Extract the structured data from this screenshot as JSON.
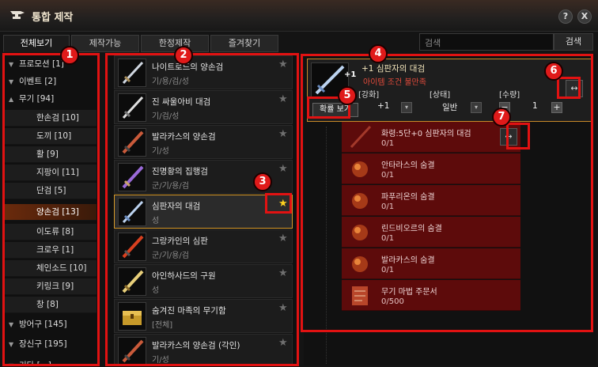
{
  "window": {
    "title": "통합 제작",
    "help_label": "?",
    "close_label": "X"
  },
  "tabs": [
    {
      "label": "전체보기"
    },
    {
      "label": "제작가능"
    },
    {
      "label": "한정제작"
    },
    {
      "label": "즐겨찾기"
    }
  ],
  "search": {
    "placeholder": "검색",
    "button_label": "검색"
  },
  "categories": [
    {
      "label": "프로모션 [1]",
      "arrow": "▼"
    },
    {
      "label": "이벤트 [2]",
      "arrow": "▼"
    },
    {
      "label": "무기 [94]",
      "arrow": "▲"
    },
    {
      "label": "한손검 [10]"
    },
    {
      "label": "도끼 [10]"
    },
    {
      "label": "활 [9]"
    },
    {
      "label": "지팡이 [11]"
    },
    {
      "label": "단검 [5]"
    },
    {
      "label": "양손검 [13]"
    },
    {
      "label": "이도류 [8]"
    },
    {
      "label": "크로우 [1]"
    },
    {
      "label": "체인소드 [10]"
    },
    {
      "label": "키링크 [9]"
    },
    {
      "label": "창 [8]"
    },
    {
      "label": "방어구 [145]",
      "arrow": "▼"
    },
    {
      "label": "장신구 [195]",
      "arrow": "▼"
    },
    {
      "label": "기타 [...]",
      "arrow": "▼"
    }
  ],
  "items": [
    {
      "name": "나이트로드의 양손검",
      "cat": "기/용/검/성",
      "star": "★"
    },
    {
      "name": "진 싸울아비 대검",
      "cat": "기/검/성",
      "star": "★"
    },
    {
      "name": "발라카스의 양손검",
      "cat": "기/성",
      "star": "★"
    },
    {
      "name": "진명황의 집행검",
      "cat": "군/기/용/검",
      "star": "★"
    },
    {
      "name": "심판자의 대검",
      "cat": "성",
      "star": "★"
    },
    {
      "name": "그랑카인의 심판",
      "cat": "군/기/용/검",
      "star": "★"
    },
    {
      "name": "아인하사드의 구원",
      "cat": "성",
      "star": "★"
    },
    {
      "name": "숨겨진 마족의 무기함",
      "cat": "[전체]",
      "star": "★"
    },
    {
      "name": "발라카스의 양손검 (각인)",
      "cat": "기/성",
      "star": "★"
    }
  ],
  "detail": {
    "plus": "+1",
    "name": "+1 심판자의 대검",
    "warning": "아이템 조건 불만족",
    "enhance_label": "[강화]",
    "enhance_value": "+1",
    "state_label": "[상태]",
    "state_value": "일반",
    "qty_label": "[수량]",
    "qty_value": "1",
    "minus": "−",
    "plus_btn": "+",
    "dropdown": "▾",
    "prob_button": "확률 보기",
    "swap": "↔"
  },
  "materials": [
    {
      "name": "화령:5단+0 심판자의 대검",
      "count": "0/1"
    },
    {
      "name": "안타라스의 숨결",
      "count": "0/1"
    },
    {
      "name": "파푸리온의 숨결",
      "count": "0/1"
    },
    {
      "name": "린드비오르의 숨결",
      "count": "0/1"
    },
    {
      "name": "발라카스의 숨결",
      "count": "0/1"
    },
    {
      "name": "무기 마법 주문서",
      "count": "0/500"
    }
  ],
  "annotations": [
    "1",
    "2",
    "3",
    "4",
    "5",
    "6",
    "7"
  ],
  "colors": {
    "annotation_red": "#e21212",
    "accent_gold": "#d89a2a",
    "warning_red": "#e34b3b",
    "material_bg": "#5d0b0b"
  }
}
